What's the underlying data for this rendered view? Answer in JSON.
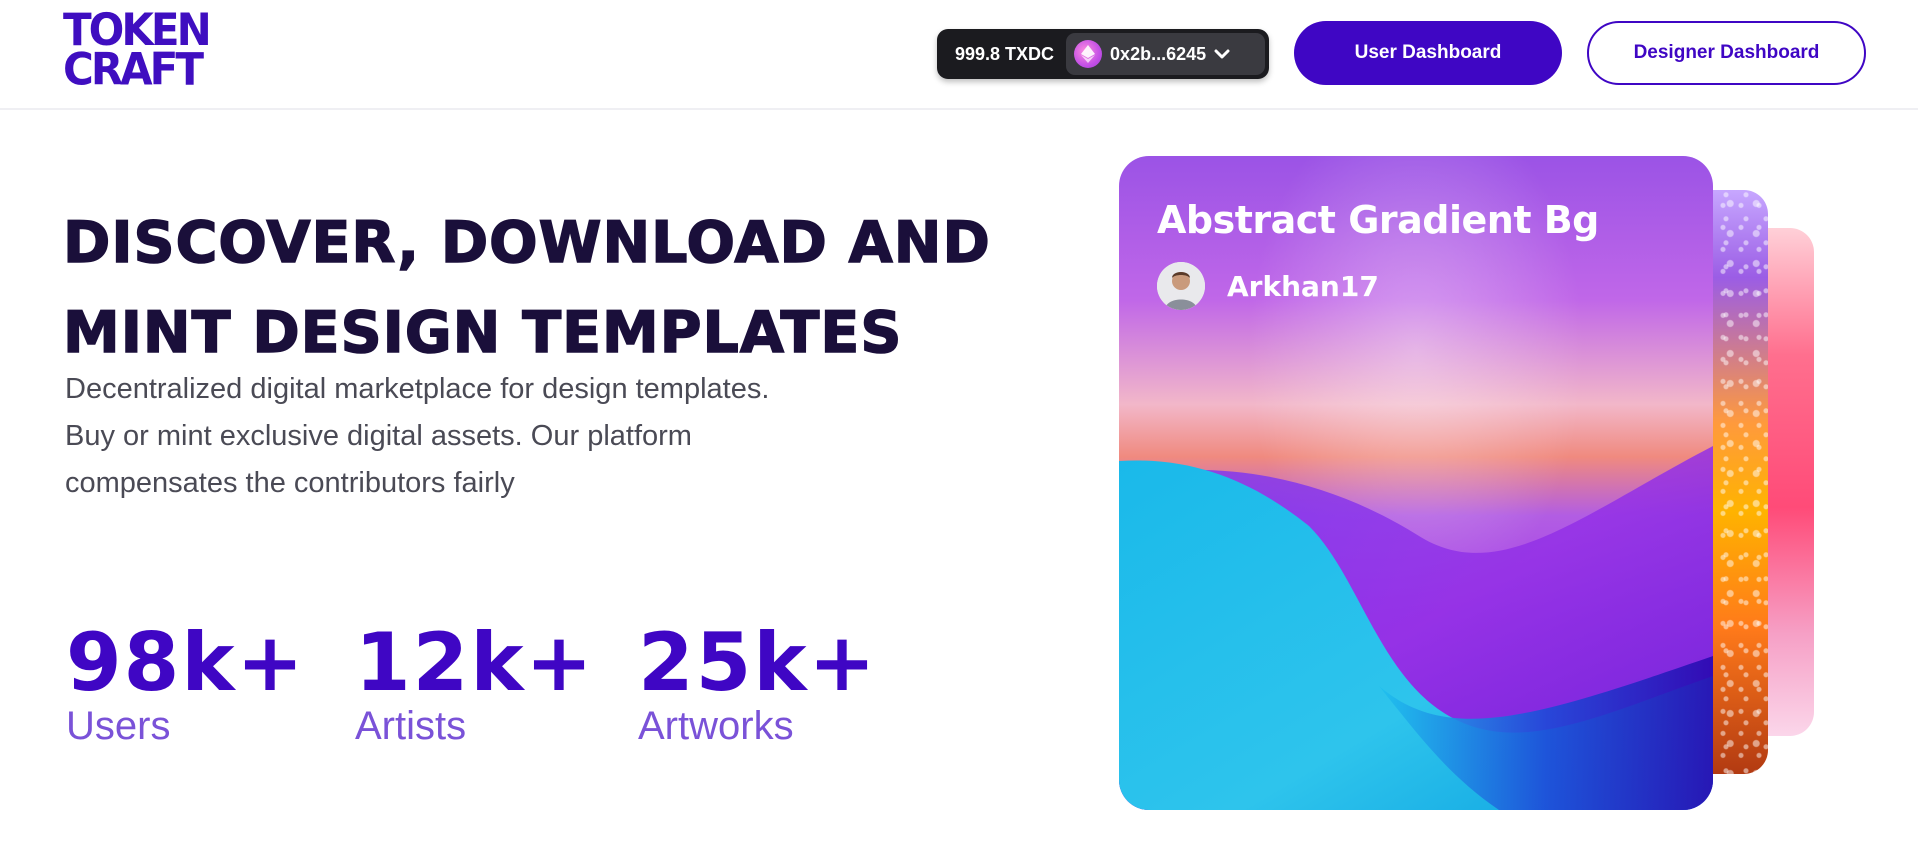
{
  "header": {
    "logo_line1": "TOKEN",
    "logo_line2": "CRAFT",
    "wallet": {
      "balance": "999.8 TXDC",
      "account": "0x2b...6245"
    },
    "user_dashboard_label": "User Dashboard",
    "designer_dashboard_label": "Designer Dashboard"
  },
  "hero": {
    "headline_line1": "DISCOVER, DOWNLOAD AND",
    "headline_line2": "MINT DESIGN TEMPLATES",
    "description": "Decentralized digital marketplace for design templates. Buy or mint exclusive digital assets. Our platform compensates the contributors fairly",
    "stats": [
      {
        "value": "98k+",
        "label": "Users"
      },
      {
        "value": "12k+",
        "label": "Artists"
      },
      {
        "value": "25k+",
        "label": "Artworks"
      }
    ]
  },
  "featured_card": {
    "title": "Abstract Gradient Bg",
    "author": "Arkhan17"
  },
  "colors": {
    "brand": "#3f06c4",
    "headline": "#1a0f3a",
    "stat_label": "#7a52d8"
  },
  "icons": {
    "account": "ethereum-token-icon",
    "dropdown": "chevron-down-icon",
    "avatar": "user-avatar-icon"
  }
}
